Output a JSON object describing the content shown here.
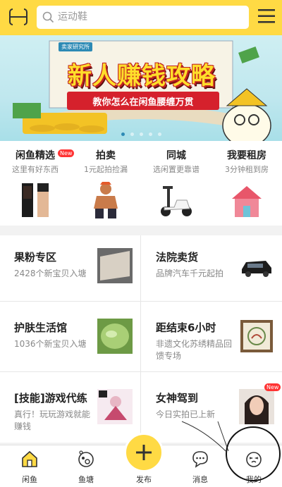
{
  "header": {
    "search_placeholder": "运动鞋",
    "brand_color": "#ffda44"
  },
  "banner": {
    "tag": "卖家研究所",
    "title": "新人赚钱攻略",
    "subtitle": "教你怎么在闲鱼腰缠万贯",
    "slide_count": 5,
    "active_slide": 1
  },
  "categories": [
    {
      "title": "闲鱼精选",
      "subtitle": "这里有好东西",
      "badge": "New",
      "icon": "makeup-product-image"
    },
    {
      "title": "拍卖",
      "subtitle": "1元起拍捡漏",
      "icon": "figure-toy-image"
    },
    {
      "title": "同城",
      "subtitle": "选闲置更靠谱",
      "icon": "scooter-image"
    },
    {
      "title": "我要租房",
      "subtitle": "3分钟租到房",
      "icon": "house-image"
    }
  ],
  "grid": [
    {
      "title": "果粉专区",
      "subtitle": "2428个新宝贝入塘",
      "icon": "laptop-image"
    },
    {
      "title": "法院卖货",
      "subtitle": "品牌汽车千元起拍",
      "icon": "car-image"
    },
    {
      "title": "护肤生活馆",
      "subtitle": "1036个新宝贝入塘",
      "icon": "mask-image"
    },
    {
      "title": "距结束6小时",
      "subtitle": "非遗文化苏绣精品回馈专场",
      "icon": "embroidery-image"
    },
    {
      "title": "[技能]游戏代练",
      "subtitle": "真行！玩玩游戏就能赚钱",
      "icon": "game-character-image"
    },
    {
      "title": "女神驾到",
      "subtitle": "今日实拍已上新",
      "badge": "New",
      "icon": "portrait-image"
    }
  ],
  "tabbar": [
    {
      "label": "闲鱼",
      "icon": "home-icon"
    },
    {
      "label": "鱼塘",
      "icon": "fishpond-icon"
    },
    {
      "label": "发布",
      "icon": "plus-icon"
    },
    {
      "label": "消息",
      "icon": "message-icon"
    },
    {
      "label": "我的",
      "icon": "profile-face-icon"
    }
  ]
}
